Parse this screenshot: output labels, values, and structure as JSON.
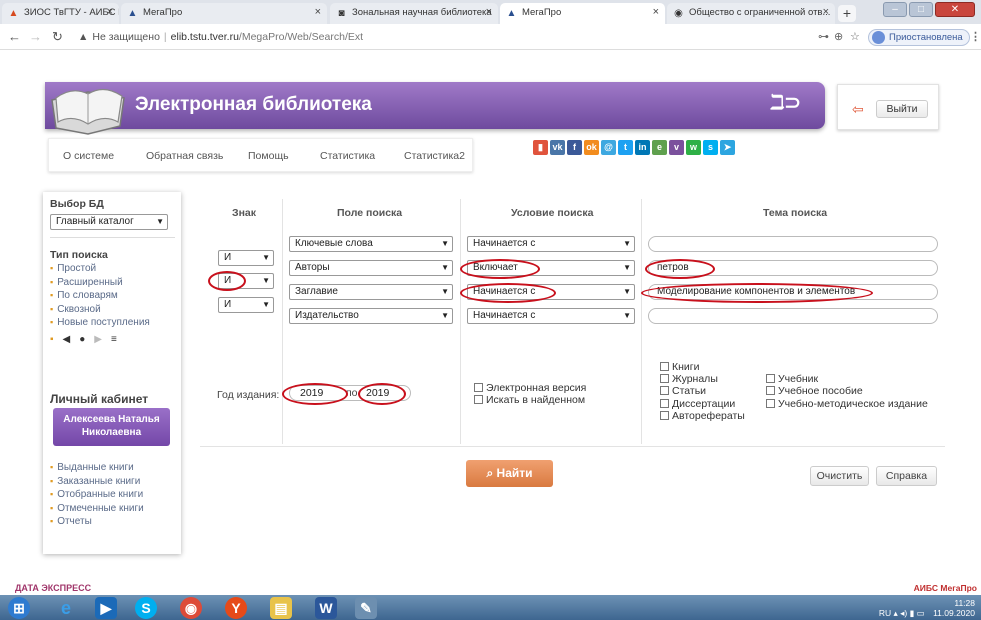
{
  "browser": {
    "tabs": [
      {
        "title": "ЗИОС ТвГТУ - АИБС МегаПро",
        "color": "#d64a1f"
      },
      {
        "title": "МегаПро",
        "color": "#2a4f8f"
      },
      {
        "title": "Зональная научная библиотека",
        "color": "#333333"
      },
      {
        "title": "МегаПро",
        "color": "#2a4f8f"
      },
      {
        "title": "Общество с ограниченной отв...",
        "color": "#555555"
      }
    ],
    "insecure_label": "Не защищено",
    "url_host": "elib.tstu.tver.ru",
    "url_path": "/MegaPro/Web/Search/Ext",
    "profile_label": "Приостановлена"
  },
  "header": {
    "title": "Электронная библиотека",
    "logo_text": "ℶ⊃",
    "exit_label": "Выйти"
  },
  "menu": [
    "О системе",
    "Обратная связь",
    "Помощь",
    "Статистика",
    "Статистика2"
  ],
  "social_colors": [
    "#e0533c",
    "#4a76a8",
    "#e08a1e",
    "#f28c1e",
    "#3ea8e0",
    "#1da1f2",
    "#0077b5",
    "#5fa04e",
    "#7b519d",
    "#2eb046",
    "#0e76a8",
    "#2ca5e0"
  ],
  "sidebar": {
    "db_heading": "Выбор БД",
    "db_value": "Главный каталог",
    "search_type_heading": "Тип поиска",
    "search_types": [
      "Простой",
      "Расширенный",
      "По словарям",
      "Сквозной",
      "Новые поступления"
    ],
    "cabinet_heading": "Личный кабинет",
    "user_name": "Алексеева Наталья Николаевна",
    "cabinet_links": [
      "Выданные книги",
      "Заказанные книги",
      "Отобранные книги",
      "Отмеченные книги",
      "Отчеты"
    ]
  },
  "search": {
    "col_sign": "Знак",
    "col_field": "Поле поиска",
    "col_condition": "Условие поиска",
    "col_topic": "Тема поиска",
    "rows": [
      {
        "sign": "",
        "field": "Ключевые слова",
        "condition": "Начинается с",
        "topic": ""
      },
      {
        "sign": "И",
        "field": "Авторы",
        "condition": "Включает",
        "topic": "петров"
      },
      {
        "sign": "И",
        "field": "Заглавие",
        "condition": "Начинается с",
        "topic": "Моделирование компонентов и элементов"
      },
      {
        "sign": "И",
        "field": "Издательство",
        "condition": "Начинается с",
        "topic": ""
      }
    ],
    "year_label": "Год издания:",
    "year_from": "2019",
    "year_to_label": "по",
    "year_to": "2019",
    "options": [
      "Электронная версия",
      "Искать в найденном"
    ],
    "doc_types_left": [
      "Книги",
      "Журналы",
      "Статьи",
      "Диссертации",
      "Авторефераты"
    ],
    "doc_types_right": [
      "Учебник",
      "Учебное пособие",
      "Учебно-методическое издание"
    ],
    "find_label": "Найти",
    "clear_label": "Очистить",
    "help_label": "Справка"
  },
  "footer": {
    "left_logo": "ДАТА ЭКСПРЕСС",
    "right_logo": "АИБС МегаПро"
  },
  "taskbar": {
    "lang": "RU",
    "time": "11:28",
    "date": "11.09.2020"
  }
}
